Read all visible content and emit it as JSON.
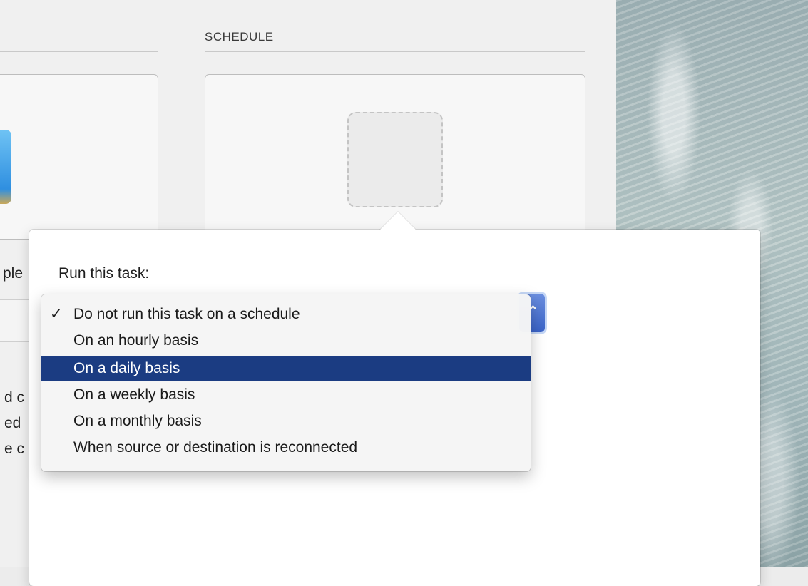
{
  "schedule": {
    "section_title": "SCHEDULE"
  },
  "left_fragments": {
    "line1": "ple",
    "line2": "d c",
    "line3": "ed",
    "line4": "e c"
  },
  "popover": {
    "label": "Run this task:",
    "popup_arrow_glyph": "⌃"
  },
  "menu": {
    "check_glyph": "✓",
    "selected_index": 0,
    "highlighted_index": 2,
    "items": [
      {
        "label": "Do not run this task on a schedule"
      },
      {
        "label": "On an hourly basis"
      },
      {
        "label": "On a daily basis"
      },
      {
        "label": "On a weekly basis"
      },
      {
        "label": "On a monthly basis"
      },
      {
        "label": "When source or destination is reconnected"
      }
    ]
  },
  "colors": {
    "highlight": "#1b3c82",
    "accent": "#3a63c8"
  }
}
